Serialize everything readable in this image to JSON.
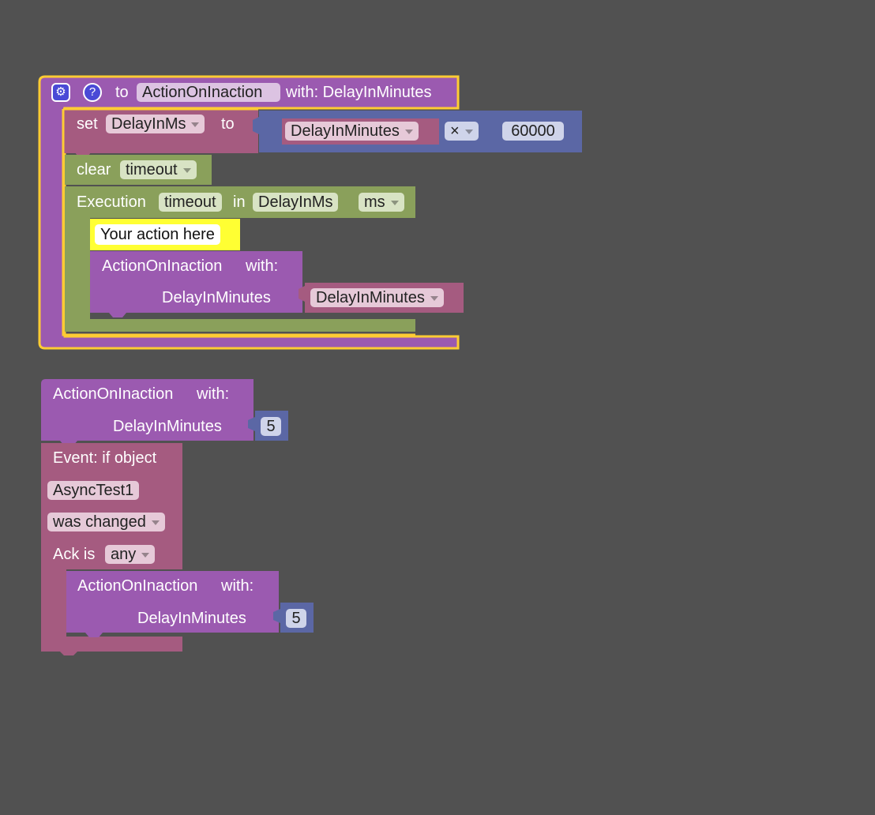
{
  "colors": {
    "background": "#515151",
    "procedure": "#9b5ab0",
    "variable": "#a55b80",
    "math": "#5b67a5",
    "timer": "#8aa05b",
    "event": "#a55b80",
    "highlight": "#ffcc33",
    "comment": "#ffff33"
  },
  "procedure_def": {
    "gear_icon": "⚙",
    "help_icon": "?",
    "to_label": "to",
    "name": "ActionOnInaction",
    "with_label": "with: DelayInMinutes"
  },
  "set_block": {
    "set_label": "set",
    "variable": "DelayInMs",
    "to_label": "to",
    "math_var": "DelayInMinutes",
    "operator": "×",
    "number": "60000"
  },
  "clear_block": {
    "label": "clear",
    "timer": "timeout"
  },
  "execution_block": {
    "label": "Execution",
    "timer": "timeout",
    "in_label": "in",
    "delay": "DelayInMs",
    "unit": "ms"
  },
  "comment_block": {
    "text": "Your action here"
  },
  "inner_call": {
    "name": "ActionOnInaction",
    "with_label": "with:",
    "param": "DelayInMinutes",
    "value": "DelayInMinutes"
  },
  "standalone_call": {
    "name": "ActionOnInaction",
    "with_label": "with:",
    "param": "DelayInMinutes",
    "value": "5"
  },
  "event_block": {
    "label": "Event: if object",
    "object": "AsyncTest1",
    "condition": "was changed",
    "ack_label": "Ack is",
    "ack_value": "any"
  },
  "event_call": {
    "name": "ActionOnInaction",
    "with_label": "with:",
    "param": "DelayInMinutes",
    "value": "5"
  }
}
